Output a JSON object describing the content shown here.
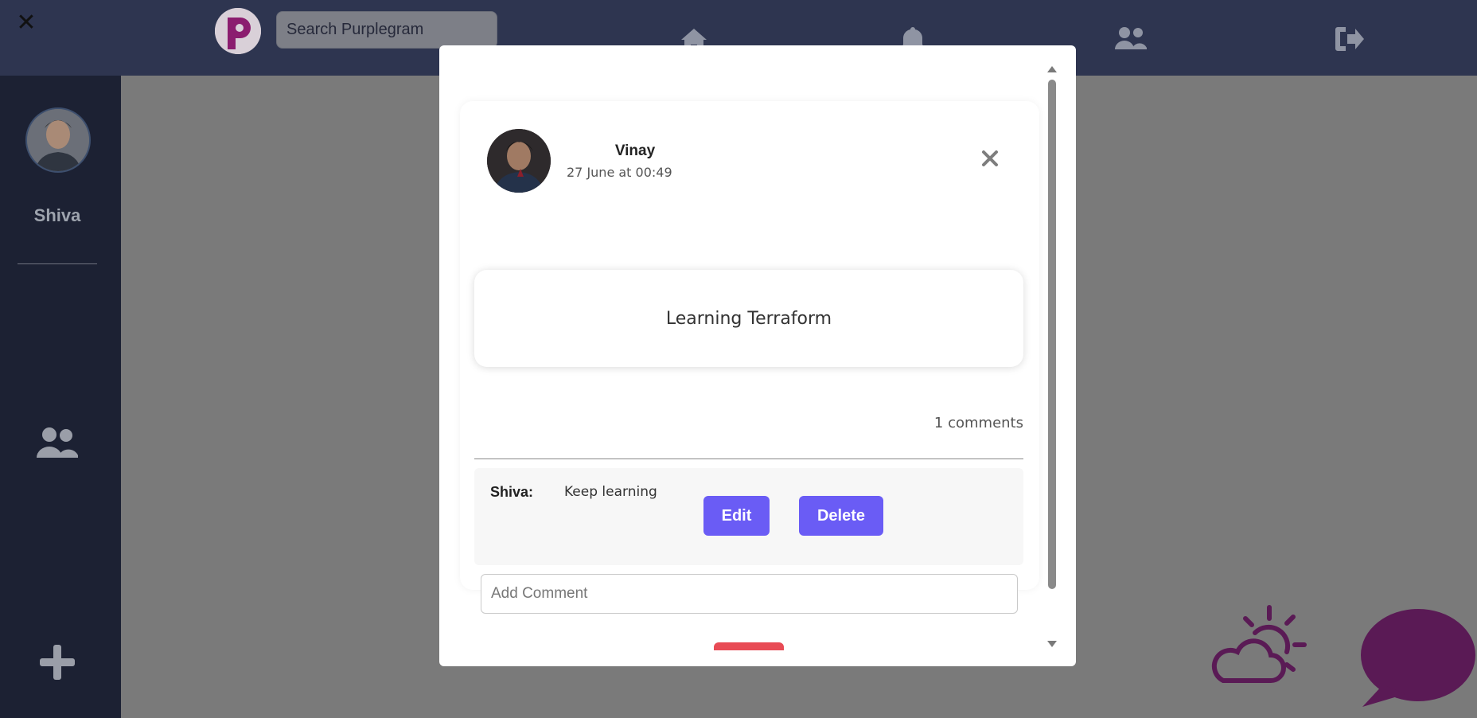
{
  "topbar": {
    "close_icon": "close-icon",
    "logo_letter": "P",
    "search_placeholder": "Search Purplegram",
    "nav_icons": [
      "home-icon",
      "bell-icon",
      "users-icon",
      "sign-out-icon"
    ]
  },
  "sidebar": {
    "user_name": "Shiva",
    "icons": [
      "users-icon",
      "plus-icon"
    ]
  },
  "post": {
    "author": "Vinay",
    "timestamp": "27 June at 00:49",
    "content": "Learning Terraform",
    "comment_count": "1 comments"
  },
  "comments": [
    {
      "user": "Shiva:",
      "text": "Keep learning",
      "edit_label": "Edit",
      "delete_label": "Delete"
    }
  ],
  "add_comment": {
    "placeholder": "Add Comment"
  },
  "colors": {
    "navbar": "#2e3550",
    "sidebar": "#1c2133",
    "accent_button": "#6a5cf5",
    "brand_purple": "#5a1a55"
  }
}
